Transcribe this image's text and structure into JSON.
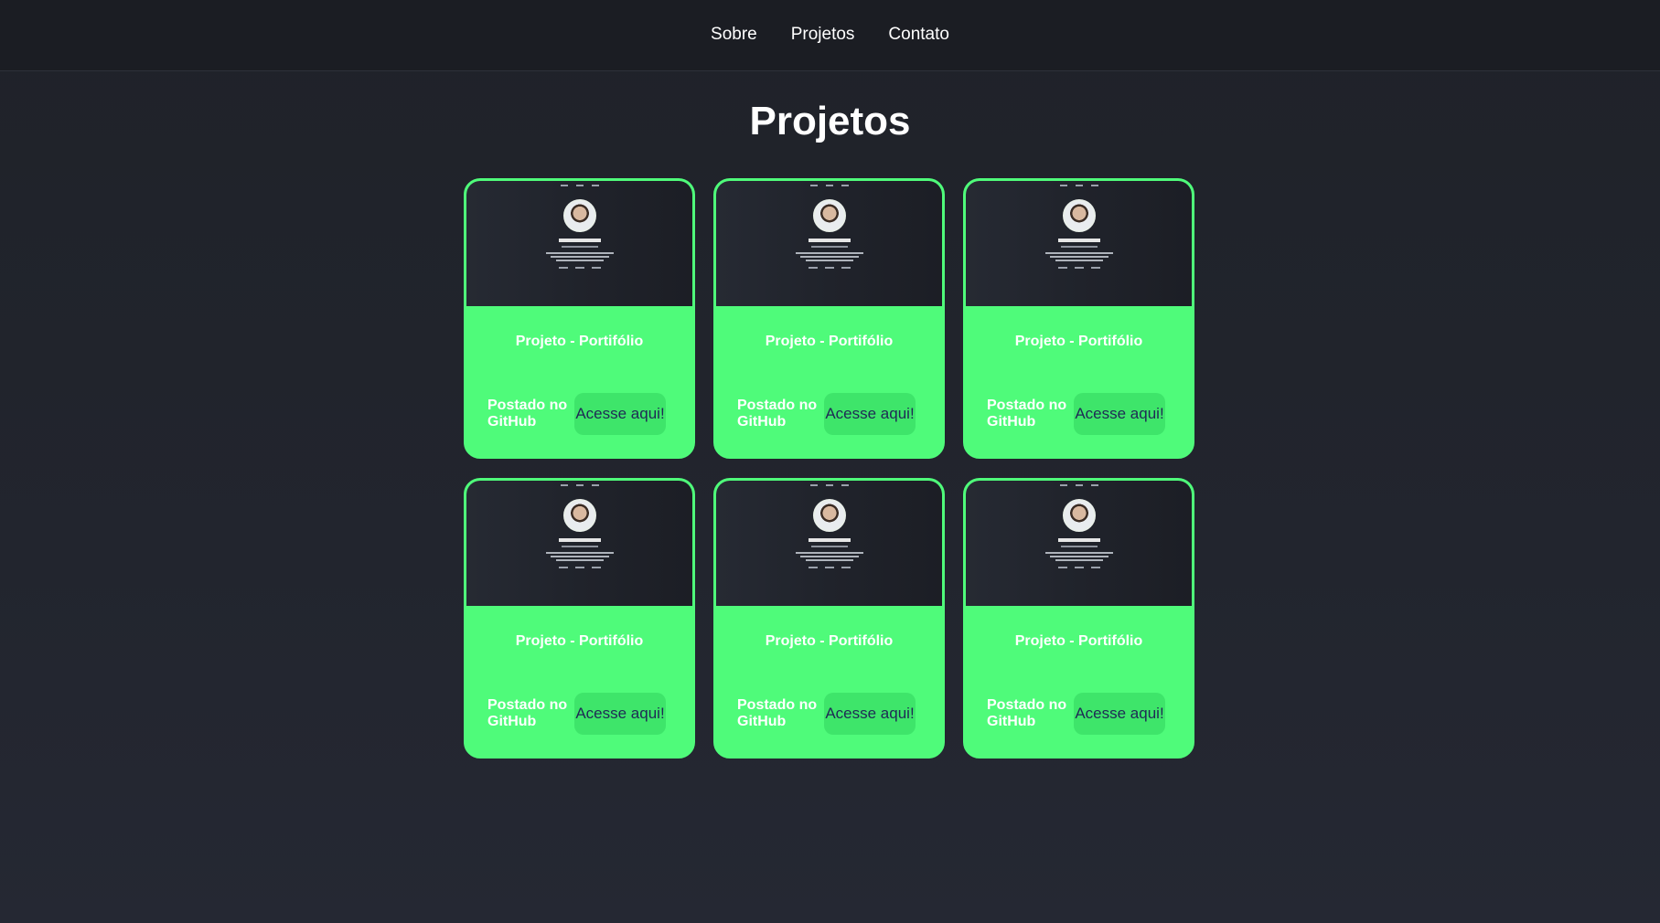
{
  "nav": {
    "items": [
      {
        "label": "Sobre"
      },
      {
        "label": "Projetos"
      },
      {
        "label": "Contato"
      }
    ]
  },
  "page": {
    "title": "Projetos"
  },
  "projects": [
    {
      "title": "Projeto - Portifólio",
      "posted": "Postado no GitHub",
      "button": "Acesse aqui!"
    },
    {
      "title": "Projeto - Portifólio",
      "posted": "Postado no GitHub",
      "button": "Acesse aqui!"
    },
    {
      "title": "Projeto - Portifólio",
      "posted": "Postado no GitHub",
      "button": "Acesse aqui!"
    },
    {
      "title": "Projeto - Portifólio",
      "posted": "Postado no GitHub",
      "button": "Acesse aqui!"
    },
    {
      "title": "Projeto - Portifólio",
      "posted": "Postado no GitHub",
      "button": "Acesse aqui!"
    },
    {
      "title": "Projeto - Portifólio",
      "posted": "Postado no GitHub",
      "button": "Acesse aqui!"
    }
  ],
  "colors": {
    "accent": "#4ffb7a",
    "button_bg": "#3ee56a",
    "button_text": "#1f2a55",
    "background": "#22252e"
  }
}
